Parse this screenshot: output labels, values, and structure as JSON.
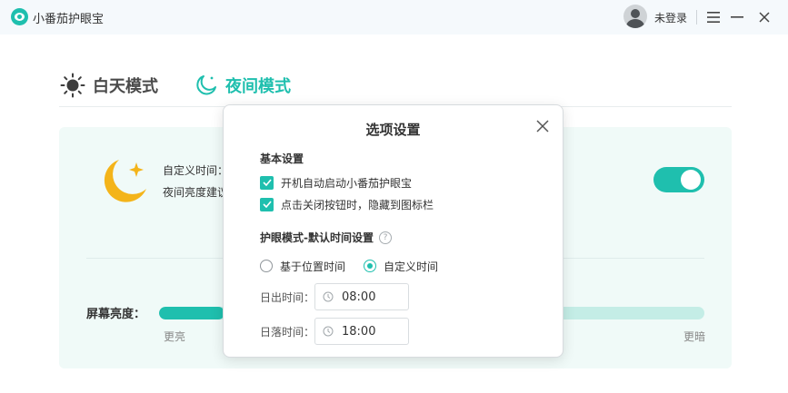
{
  "app": {
    "title": "小番茄护眼宝",
    "user_label": "未登录"
  },
  "tabs": [
    {
      "label": "白天模式",
      "icon": "sun-icon",
      "active": false
    },
    {
      "label": "夜间模式",
      "icon": "moon-icon",
      "active": true
    }
  ],
  "night_card": {
    "text_custom_time": "自定义时间：",
    "text_brightness_tip": "夜间亮度建议",
    "toggle_on": true,
    "brightness_label": "屏幕亮度：",
    "brightness_min_label": "更亮",
    "brightness_max_label": "更暗",
    "brightness_value": 0.12
  },
  "dialog": {
    "title": "选项设置",
    "basic_section_title": "基本设置",
    "option_autostart": "开机自动启动小番茄护眼宝",
    "option_hide_to_tray": "点击关闭按钮时，隐藏到图标栏",
    "eye_section_title": "护眼模式-默认时间设置",
    "help_glyph": "?",
    "radio_location": "基于位置时间",
    "radio_custom": "自定义时间",
    "sunrise_label": "日出时间：",
    "sunrise_value": "08:00",
    "sunset_label": "日落时间：",
    "sunset_value": "18:00"
  },
  "colors": {
    "accent": "#1fbfae",
    "card_bg": "#f0faf8",
    "slider_track": "#c4ede6",
    "moon": "#f4b41a"
  }
}
